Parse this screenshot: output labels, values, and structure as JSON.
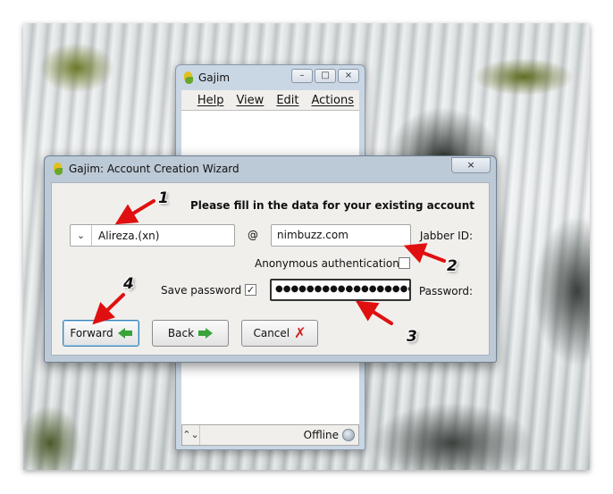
{
  "roster_window": {
    "title": "Gajim",
    "window_buttons": [
      "–",
      "□",
      "×"
    ],
    "menu": [
      "Help",
      "View",
      "Edit",
      "Actions"
    ],
    "status": "Offline",
    "status_spinner": "⌃⌄"
  },
  "wizard": {
    "title": "Gajim: Account Creation Wizard",
    "close_glyph": "×",
    "heading": "Please fill in the data for your existing account",
    "username": "Alireza.(xn)",
    "combo_arrow": "⌄",
    "at_sign": "@",
    "server": "nimbuzz.com",
    "jid_label": "Jabber ID:",
    "anonymous_label": "Anonymous authentication",
    "anonymous_checked": false,
    "save_password_label": "Save password",
    "save_password_checked": true,
    "password_mask": "●●●●●●●●●●●●●●●●●●●",
    "password_label": "Password:",
    "buttons": {
      "forward": "Forward",
      "back": "Back",
      "cancel": "Cancel"
    }
  },
  "annotations": [
    "1",
    "2",
    "3",
    "4"
  ],
  "colors": {
    "annotation_arrow": "#e01010",
    "titlebar": "#bcc9d6",
    "dialog_body": "#f0efeb",
    "accept_arrow": "#3aa33a",
    "cancel_x": "#d42020"
  }
}
